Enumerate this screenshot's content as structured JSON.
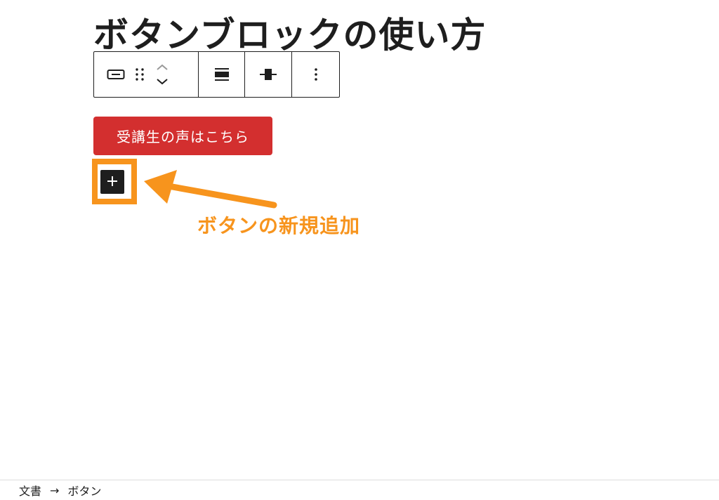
{
  "editor": {
    "post_title": "ボタンブロックの使い方"
  },
  "toolbar": {
    "buttons": [
      {
        "label": "block-type",
        "icon": "button-block-icon"
      },
      {
        "label": "drag",
        "icon": "drag-handle-icon"
      },
      {
        "label": "move-up",
        "icon": "chevron-up-icon"
      },
      {
        "label": "move-down",
        "icon": "chevron-down-icon"
      },
      {
        "label": "justification",
        "icon": "justify-stretch-icon"
      },
      {
        "label": "vertical-alignment",
        "icon": "align-center-icon"
      },
      {
        "label": "options",
        "icon": "more-vertical-icon"
      }
    ]
  },
  "content": {
    "button_text": "受講生の声はこちら"
  },
  "annotation": {
    "label": "ボタンの新規追加"
  },
  "breadcrumb": {
    "items": [
      "文書",
      "ボタン"
    ],
    "separator": "→"
  },
  "colors": {
    "button_bg": "#d32f2f",
    "highlight": "#f7941d",
    "text": "#1e1e1e"
  }
}
